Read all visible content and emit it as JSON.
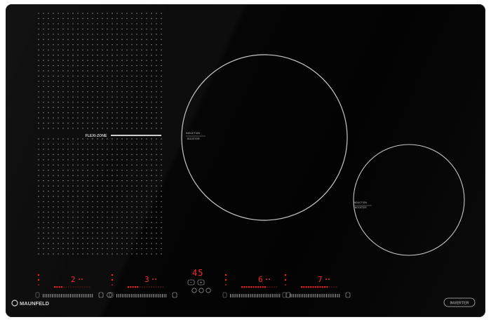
{
  "flexi_zone_label": "FLEXI-ZONE",
  "zone_center": {
    "line1": "INDUCTION",
    "line2": "BOOSTER"
  },
  "zone_right": {
    "line1": "INDUCTION",
    "line2": "BOOSTER"
  },
  "controls": [
    {
      "level": "2"
    },
    {
      "level": "3"
    },
    {
      "level": "6"
    },
    {
      "level": "7"
    }
  ],
  "timer_display": "45",
  "brand": "MAUNFELD",
  "inverter_badge": "INVERTER",
  "colors": {
    "glass": "#050505",
    "display": "#ff2222",
    "print": "#bdbdbd"
  }
}
